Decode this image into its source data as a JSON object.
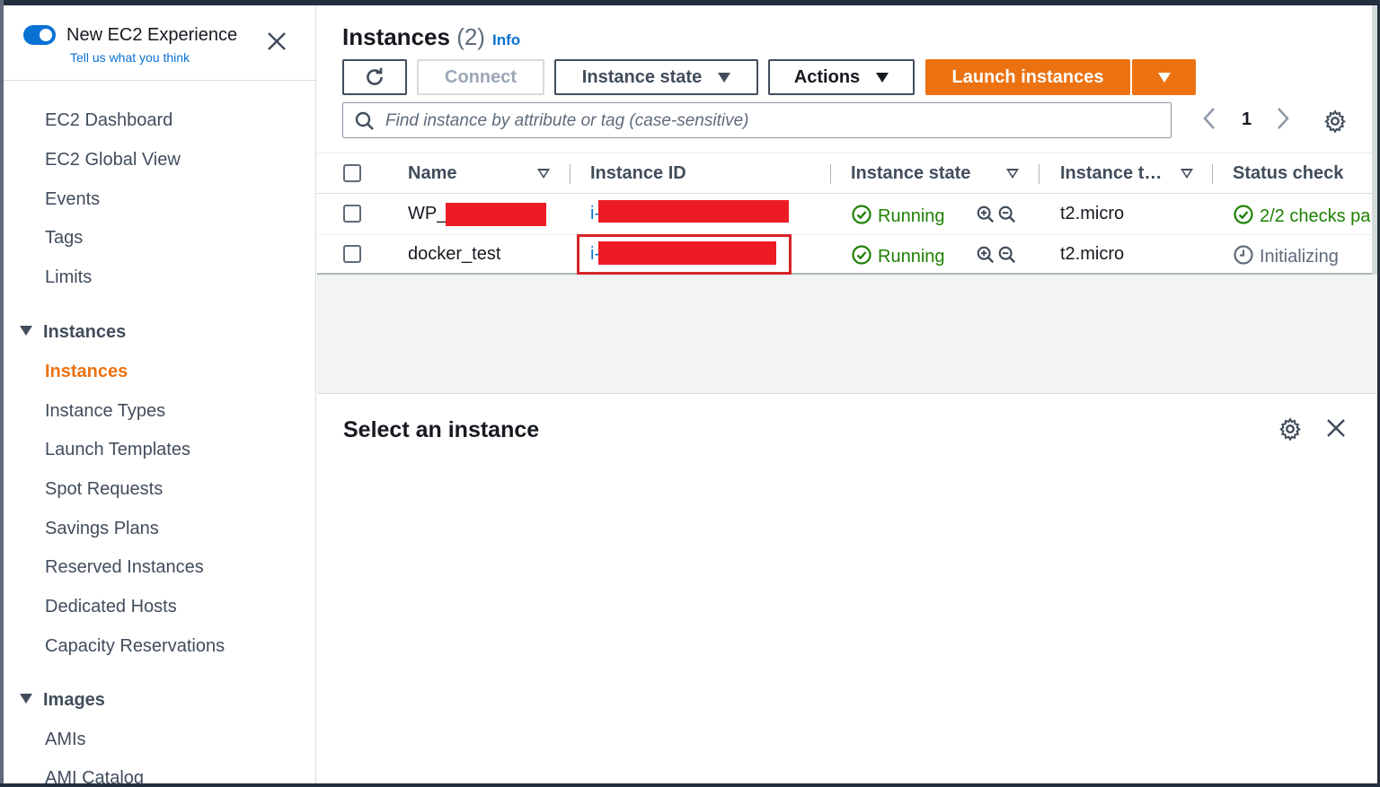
{
  "sidebar": {
    "experience_title": "New EC2 Experience",
    "experience_link": "Tell us what you think",
    "toggle_on": true,
    "items": [
      {
        "label": "EC2 Dashboard"
      },
      {
        "label": "EC2 Global View"
      },
      {
        "label": "Events"
      },
      {
        "label": "Tags"
      },
      {
        "label": "Limits"
      }
    ],
    "sections": [
      {
        "label": "Instances",
        "items": [
          {
            "label": "Instances",
            "active": true
          },
          {
            "label": "Instance Types"
          },
          {
            "label": "Launch Templates"
          },
          {
            "label": "Spot Requests"
          },
          {
            "label": "Savings Plans"
          },
          {
            "label": "Reserved Instances"
          },
          {
            "label": "Dedicated Hosts"
          },
          {
            "label": "Capacity Reservations"
          }
        ]
      },
      {
        "label": "Images",
        "items": [
          {
            "label": "AMIs"
          },
          {
            "label": "AMI Catalog"
          }
        ]
      }
    ]
  },
  "header": {
    "title": "Instances",
    "count": "(2)",
    "info": "Info"
  },
  "toolbar": {
    "connect": "Connect",
    "instance_state": "Instance state",
    "actions": "Actions",
    "launch": "Launch instances"
  },
  "search": {
    "placeholder": "Find instance by attribute or tag (case-sensitive)"
  },
  "pagination": {
    "page": "1"
  },
  "table": {
    "columns": [
      "Name",
      "Instance ID",
      "Instance state",
      "Instance t…",
      "Status check"
    ],
    "rows": [
      {
        "name": "WP_",
        "id_prefix": "i-",
        "state": "Running",
        "type": "t2.micro",
        "status": "2/2 checks pa"
      },
      {
        "name": "docker_test",
        "id_prefix": "i-",
        "state": "Running",
        "type": "t2.micro",
        "status": "Initializing"
      }
    ]
  },
  "details": {
    "title": "Select an instance"
  },
  "colors": {
    "accent": "#ec7211",
    "link": "#0972d3",
    "success": "#1d8102",
    "redaction": "#ed1c24",
    "highlight": "#d8232a"
  }
}
